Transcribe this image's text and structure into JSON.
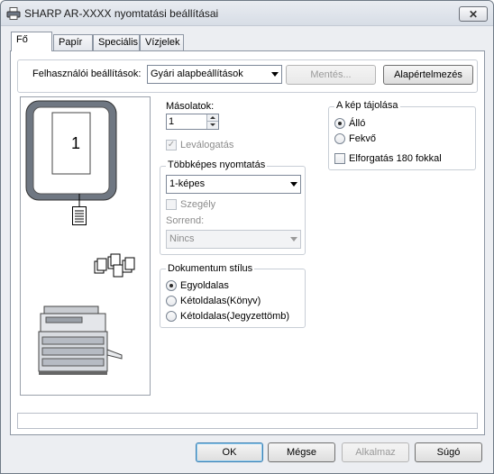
{
  "window": {
    "title": "SHARP AR-XXXX nyomtatási beállításai"
  },
  "tabs": [
    {
      "label": "Fő"
    },
    {
      "label": "Papír"
    },
    {
      "label": "Speciális"
    },
    {
      "label": "Vízjelek"
    }
  ],
  "settings": {
    "user_settings_label": "Felhasználói beállítások:",
    "user_settings_value": "Gyári alapbeállítások",
    "save_label": "Mentés...",
    "defaults_label": "Alapértelmezés"
  },
  "preview": {
    "page_number": "1"
  },
  "copies": {
    "label": "Másolatok:",
    "value": "1",
    "collate_label": "Leválogatás"
  },
  "multiup": {
    "title": "Többképes nyomtatás",
    "value": "1-képes",
    "border_label": "Szegély",
    "order_label": "Sorrend:",
    "order_value": "Nincs"
  },
  "orientation": {
    "title": "A kép tájolása",
    "options": [
      "Álló",
      "Fekvő"
    ],
    "selected": "Álló",
    "rotate_label": "Elforgatás 180 fokkal"
  },
  "document_style": {
    "title": "Dokumentum stílus",
    "options": [
      "Egyoldalas",
      "Kétoldalas(Könyv)",
      "Kétoldalas(Jegyzettömb)"
    ],
    "selected": "Egyoldalas"
  },
  "footer": {
    "ok": "OK",
    "cancel": "Mégse",
    "apply": "Alkalmaz",
    "help": "Súgó"
  }
}
